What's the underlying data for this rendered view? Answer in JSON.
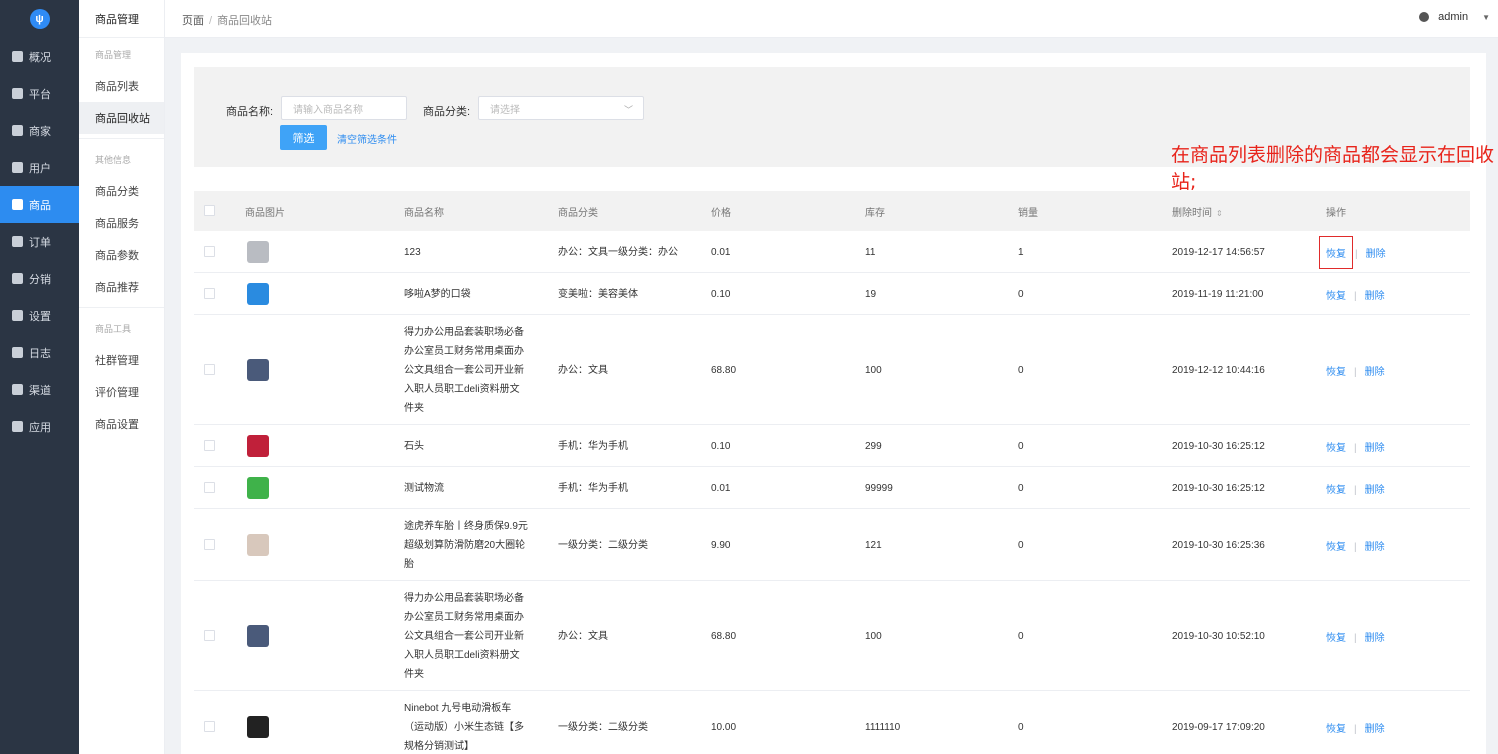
{
  "main_nav": {
    "items": [
      {
        "label": "概况",
        "icon": "monitor-icon"
      },
      {
        "label": "平台",
        "icon": "desktop-icon"
      },
      {
        "label": "商家",
        "icon": "store-icon"
      },
      {
        "label": "用户",
        "icon": "user-icon"
      },
      {
        "label": "商品",
        "icon": "goods-icon"
      },
      {
        "label": "订单",
        "icon": "order-icon"
      },
      {
        "label": "分销",
        "icon": "distribution-icon"
      },
      {
        "label": "设置",
        "icon": "gear-icon"
      },
      {
        "label": "日志",
        "icon": "log-icon"
      },
      {
        "label": "渠道",
        "icon": "channel-icon"
      },
      {
        "label": "应用",
        "icon": "apps-icon"
      }
    ],
    "active": "商品"
  },
  "sub_nav": {
    "title": "商品管理",
    "group1": "商品管理",
    "group1_items": [
      "商品列表",
      "商品回收站"
    ],
    "group2": "其他信息",
    "group2_items": [
      "商品分类",
      "商品服务",
      "商品参数",
      "商品推荐"
    ],
    "group3": "商品工具",
    "group3_items": [
      "社群管理",
      "评价管理",
      "商品设置"
    ],
    "active": "商品回收站"
  },
  "header": {
    "crumb_root": "页面",
    "crumb_sep": "/",
    "crumb_current": "商品回收站",
    "user": "admin"
  },
  "filter": {
    "name_label": "商品名称:",
    "name_placeholder": "请输入商品名称",
    "category_label": "商品分类:",
    "category_placeholder": "请选择",
    "filter_button": "筛选",
    "clear_link": "清空筛选条件"
  },
  "annotation": "在商品列表删除的商品都会显示在回收站;",
  "table": {
    "columns": [
      "商品图片",
      "商品名称",
      "商品分类",
      "价格",
      "库存",
      "销量",
      "删除时间",
      "操作"
    ],
    "restore_label": "恢复",
    "delete_label": "删除",
    "divider": "|",
    "rows": [
      {
        "name": [
          "123"
        ],
        "category": "办公：文具一级分类：办公",
        "price": "0.01",
        "stock": "11",
        "sales": "1",
        "deleted_at": "2019-12-17 14:56:57",
        "thumb_color": "#b9bcc2"
      },
      {
        "name": [
          "哆啦A梦的口袋"
        ],
        "category": "变美啦：美容美体",
        "price": "0.10",
        "stock": "19",
        "sales": "0",
        "deleted_at": "2019-11-19 11:21:00",
        "thumb_color": "#2a8be0"
      },
      {
        "name": [
          "得力办公用品套装职场必备",
          "办公室员工财务常用桌面办",
          "公文具组合一套公司开业新",
          "入职人员职工deli资料册文",
          "件夹"
        ],
        "category": "办公：文具",
        "price": "68.80",
        "stock": "100",
        "sales": "0",
        "deleted_at": "2019-12-12 10:44:16",
        "thumb_color": "#4a5a7a"
      },
      {
        "name": [
          "石头"
        ],
        "category": "手机：华为手机",
        "price": "0.10",
        "stock": "299",
        "sales": "0",
        "deleted_at": "2019-10-30 16:25:12",
        "thumb_color": "#c0203a"
      },
      {
        "name": [
          "测试物流"
        ],
        "category": "手机：华为手机",
        "price": "0.01",
        "stock": "99999",
        "sales": "0",
        "deleted_at": "2019-10-30 16:25:12",
        "thumb_color": "#3fb24a"
      },
      {
        "name": [
          "途虎养车胎丨终身质保9.9元",
          "超级划算防滑防磨20大圈轮",
          "胎"
        ],
        "category": "一级分类：二级分类",
        "price": "9.90",
        "stock": "121",
        "sales": "0",
        "deleted_at": "2019-10-30 16:25:36",
        "thumb_color": "#d8c8bc"
      },
      {
        "name": [
          "得力办公用品套装职场必备",
          "办公室员工财务常用桌面办",
          "公文具组合一套公司开业新",
          "入职人员职工deli资料册文",
          "件夹"
        ],
        "category": "办公：文具",
        "price": "68.80",
        "stock": "100",
        "sales": "0",
        "deleted_at": "2019-10-30 10:52:10",
        "thumb_color": "#4a5a7a"
      },
      {
        "name": [
          "Ninebot 九号电动滑板车",
          "（运动版）小米生态链【多",
          "规格分销测试】"
        ],
        "category": "一级分类：二级分类",
        "price": "10.00",
        "stock": "1111110",
        "sales": "0",
        "deleted_at": "2019-09-17 17:09:20",
        "thumb_color": "#222222"
      }
    ]
  }
}
